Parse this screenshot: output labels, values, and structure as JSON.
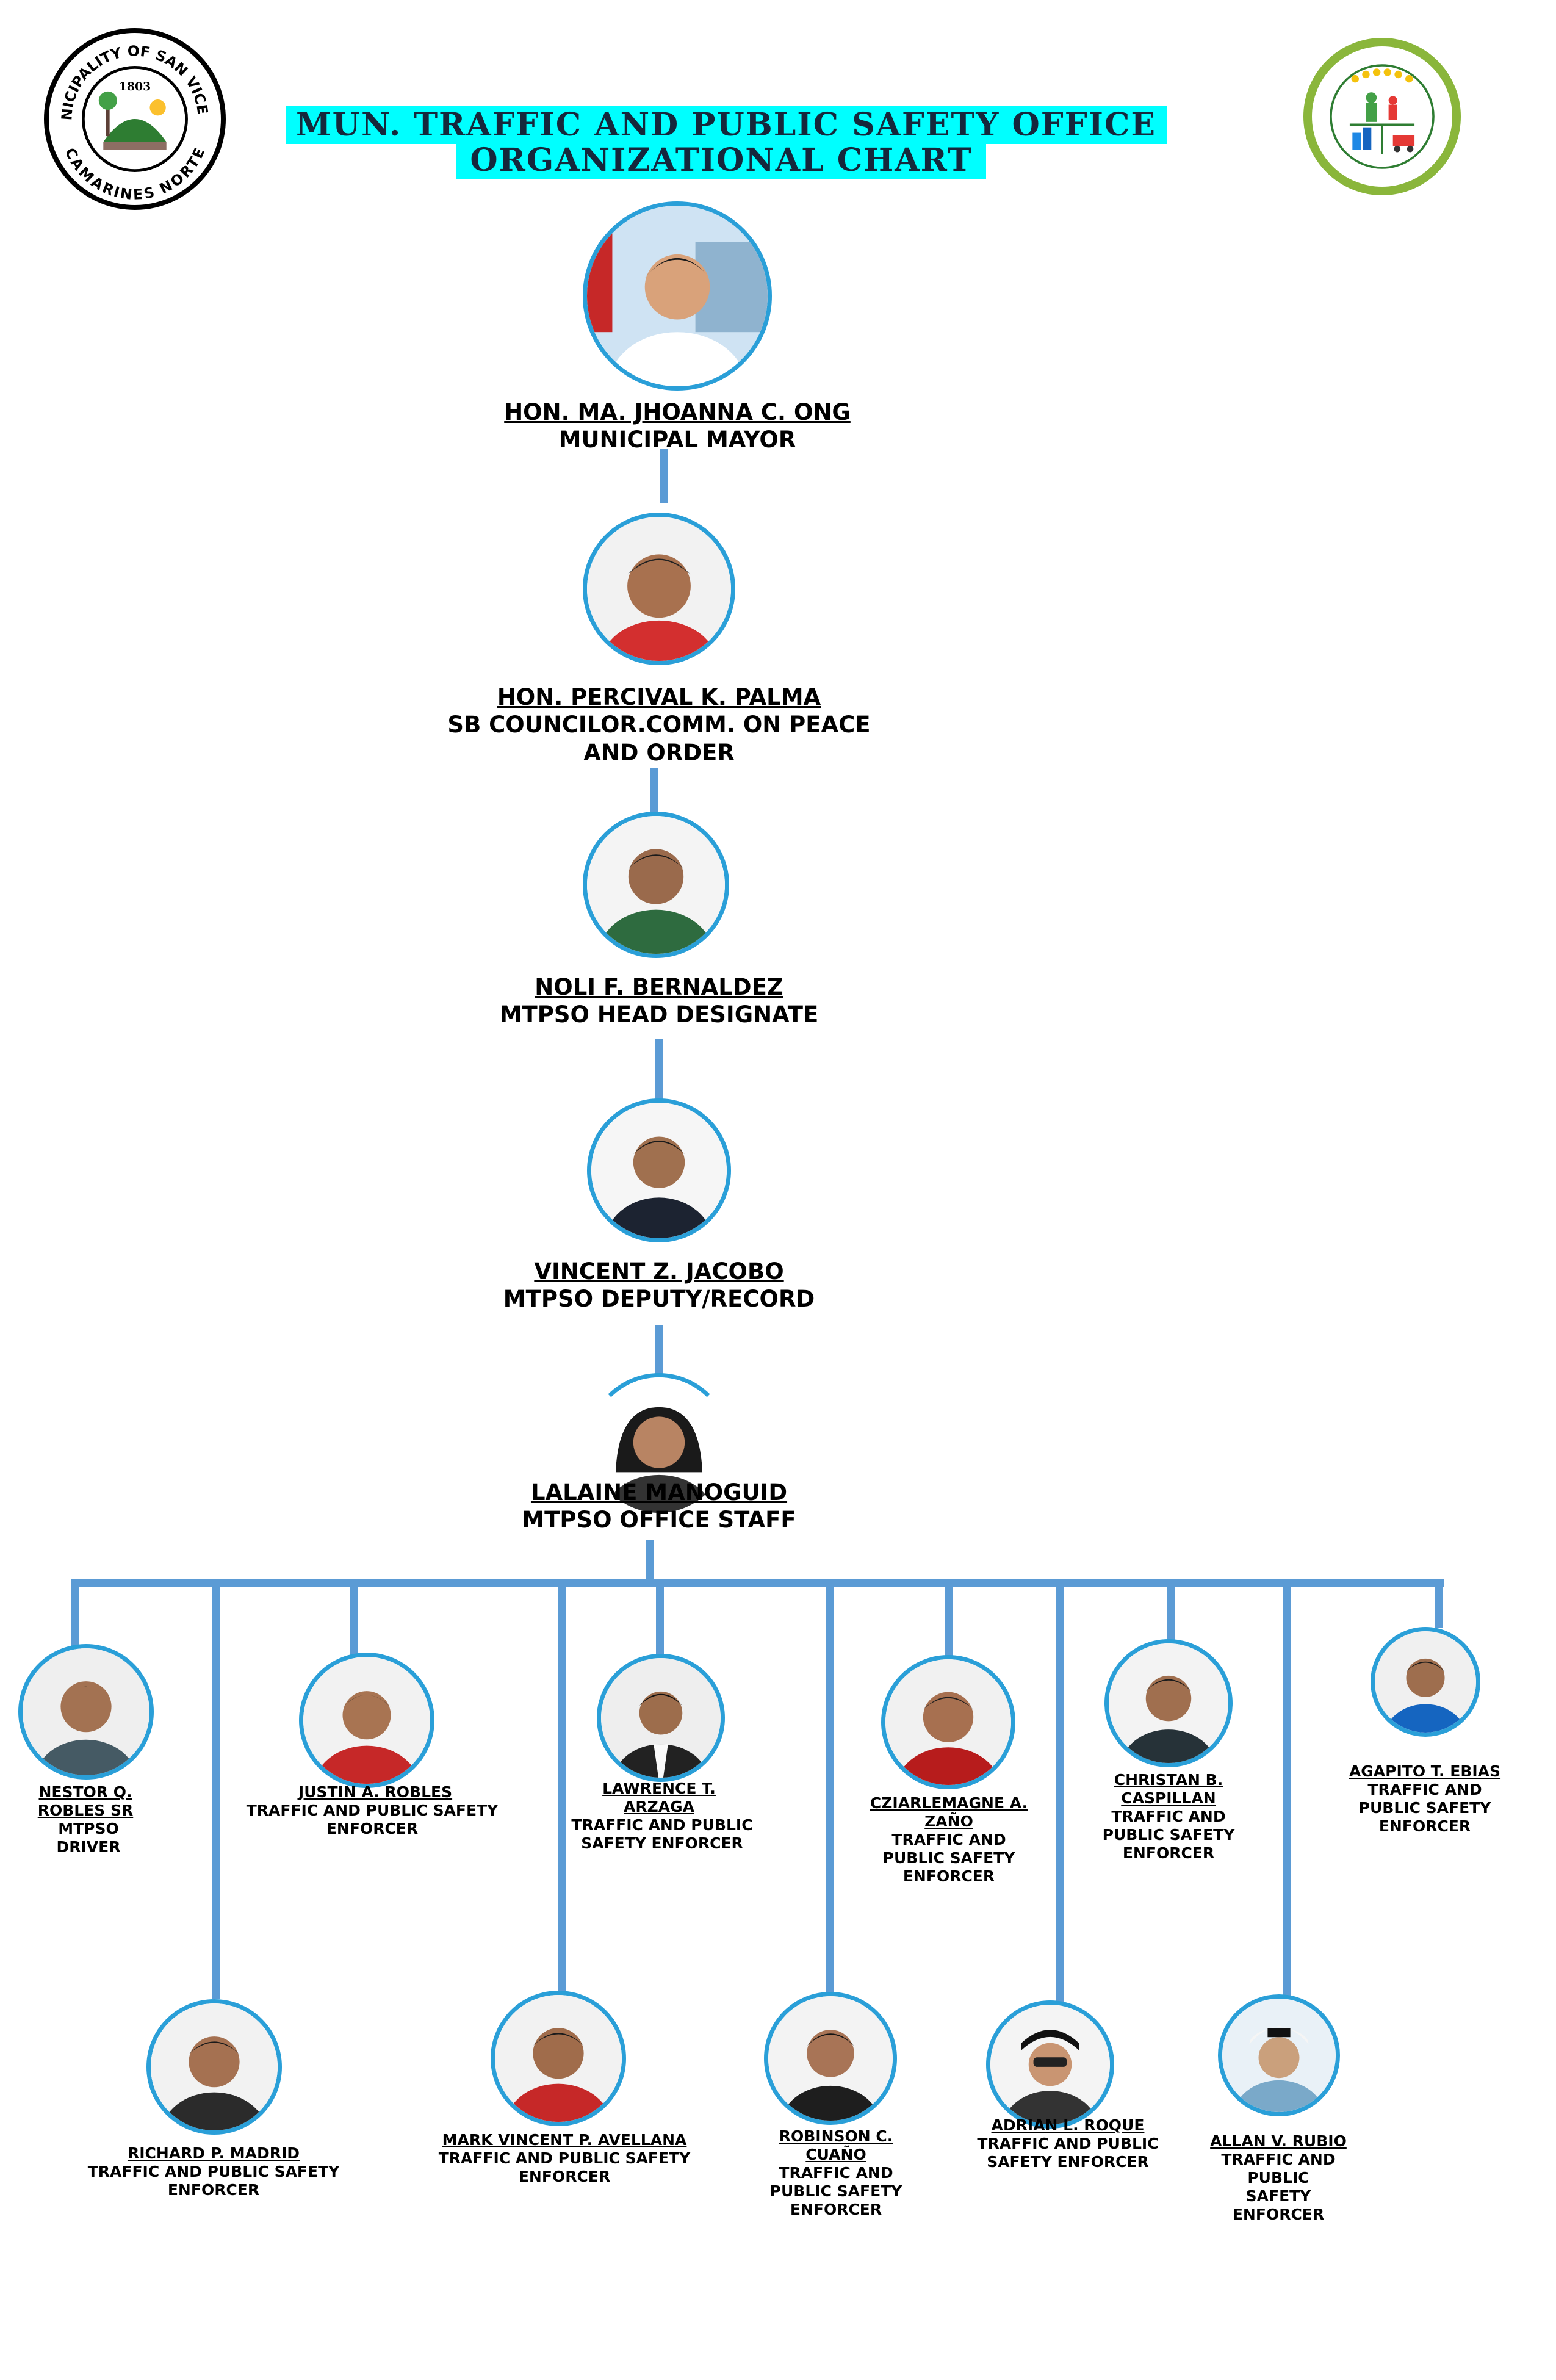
{
  "header": {
    "left_seal": {
      "top_text": "MUNICIPALITY OF SAN VICENTE",
      "year": "1803",
      "bottom_text": "CAMARINES NORTE"
    },
    "title_line1": "MUN. TRAFFIC AND PUBLIC SAFETY OFFICE",
    "title_line2": "ORGANIZATIONAL CHART"
  },
  "chain": [
    {
      "name": "HON. MA. JHOANNA C. ONG",
      "role": "MUNICIPAL MAYOR"
    },
    {
      "name": "HON. PERCIVAL K. PALMA",
      "role": "SB COUNCILOR.COMM. ON PEACE AND ORDER"
    },
    {
      "name": "NOLI F. BERNALDEZ",
      "role": "MTPSO HEAD DESIGNATE"
    },
    {
      "name": "VINCENT Z. JACOBO",
      "role": "MTPSO DEPUTY/RECORD"
    },
    {
      "name": "LALAINE MANOGUID",
      "role": "MTPSO OFFICE STAFF"
    }
  ],
  "staff": [
    {
      "name": "NESTOR Q. ROBLES SR",
      "role": "MTPSO DRIVER"
    },
    {
      "name": "JUSTIN A. ROBLES",
      "role": "TRAFFIC AND PUBLIC SAFETY ENFORCER"
    },
    {
      "name": "LAWRENCE T. ARZAGA",
      "role": "TRAFFIC AND PUBLIC SAFETY ENFORCER"
    },
    {
      "name": "CZIARLEMAGNE A. ZAÑO",
      "role": "TRAFFIC AND PUBLIC SAFETY ENFORCER"
    },
    {
      "name": "CHRISTAN B. CASPILLAN",
      "role": "TRAFFIC AND PUBLIC SAFETY ENFORCER"
    },
    {
      "name": "AGAPITO T. EBIAS",
      "role": "TRAFFIC AND PUBLIC SAFETY ENFORCER"
    },
    {
      "name": "RICHARD P. MADRID",
      "role": "TRAFFIC AND PUBLIC SAFETY ENFORCER"
    },
    {
      "name": "MARK VINCENT P. AVELLANA",
      "role": "TRAFFIC AND PUBLIC SAFETY ENFORCER"
    },
    {
      "name": "ROBINSON C. CUAÑO",
      "role": "TRAFFIC AND PUBLIC SAFETY ENFORCER"
    },
    {
      "name": "ADRIAN L. ROQUE",
      "role": "TRAFFIC AND PUBLIC SAFETY ENFORCER"
    },
    {
      "name": "ALLAN V. RUBIO",
      "role": "TRAFFIC AND PUBLIC SAFETY ENFORCER"
    }
  ],
  "colors": {
    "accent": "#2a9fd8",
    "connector": "#5b9bd5",
    "title_bg": "#00ffff"
  }
}
